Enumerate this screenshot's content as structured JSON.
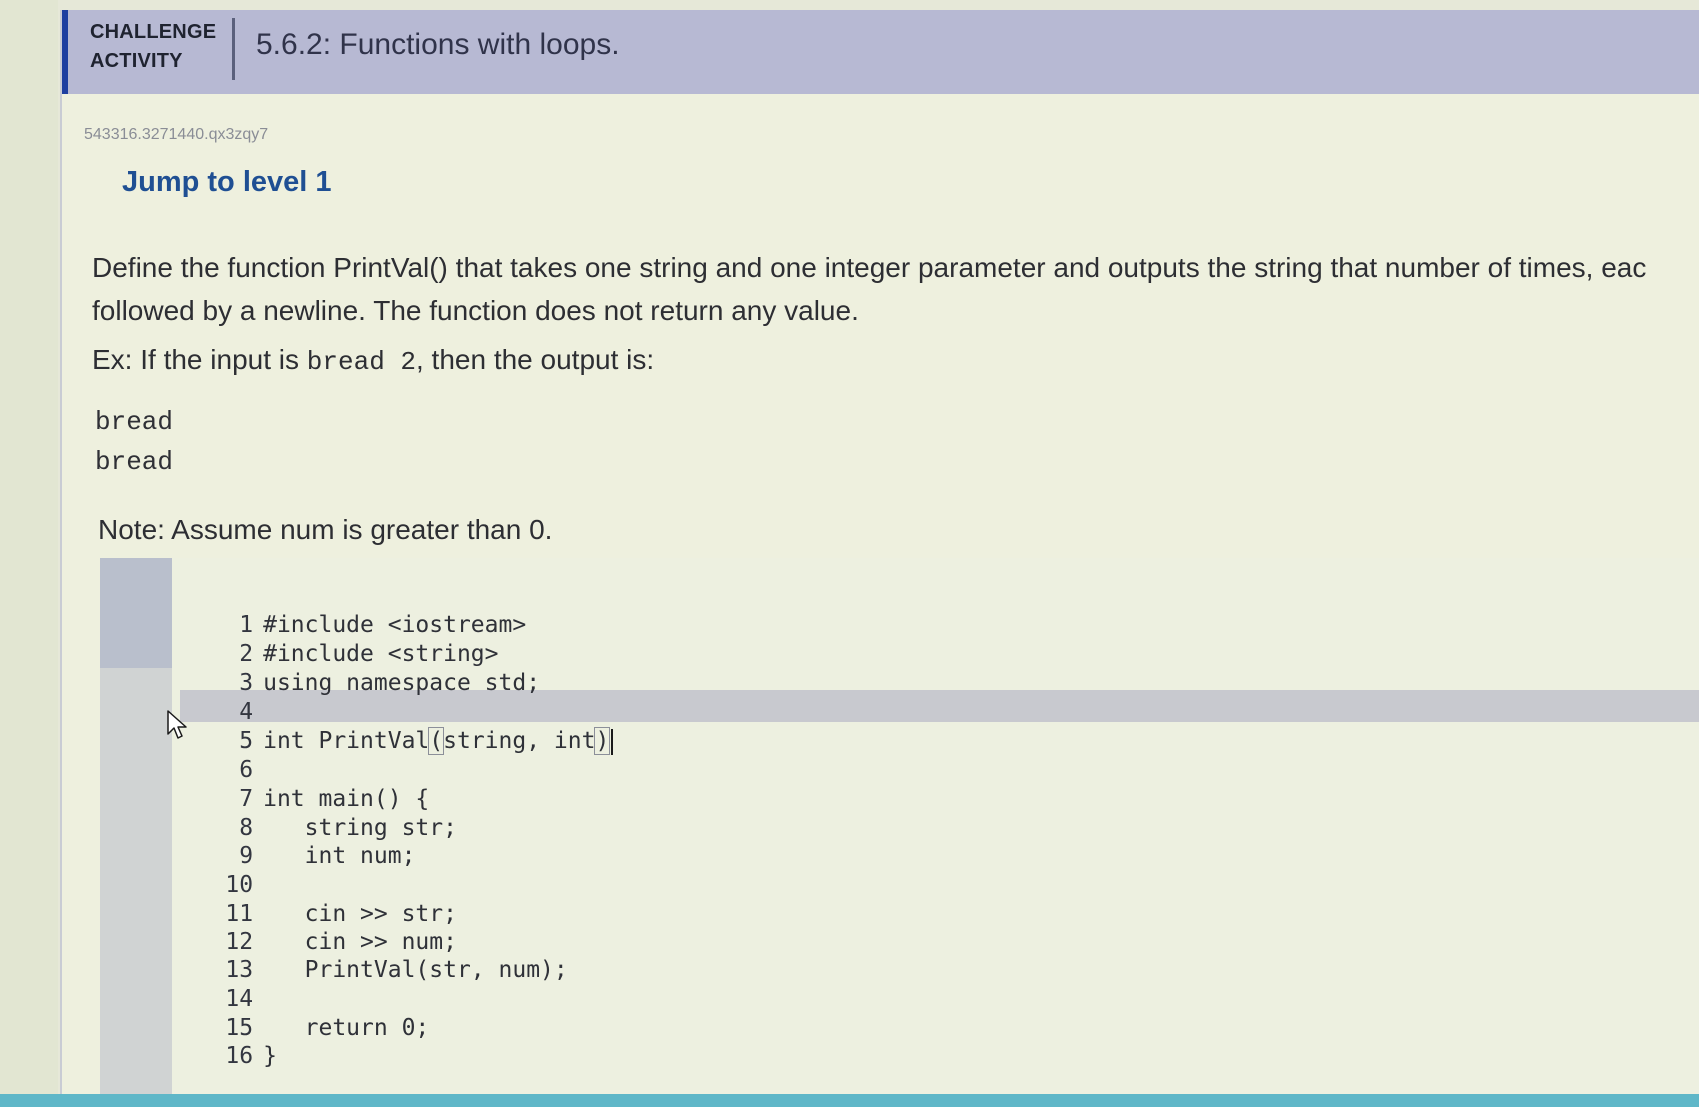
{
  "header": {
    "kind_line1": "CHALLENGE",
    "kind_line2": "ACTIVITY",
    "title": "5.6.2: Functions with loops."
  },
  "activity_id": "543316.3271440.qx3zqy7",
  "jump_level": "Jump to level 1",
  "prompt": {
    "line1": "Define the function PrintVal() that takes one string and one integer parameter and outputs the string that number of times, eac",
    "line2": "followed by a newline. The function does not return any value."
  },
  "example": {
    "prefix": "Ex: If the input is ",
    "input_code": "bread 2",
    "suffix": ", then the output is:"
  },
  "expected_output": [
    "bread",
    "bread"
  ],
  "note": "Note: Assume num is greater than 0.",
  "editor": {
    "lines": [
      {
        "num": "1",
        "code": "#include <iostream>"
      },
      {
        "num": "2",
        "code": "#include <string>"
      },
      {
        "num": "3",
        "code": "using namespace std;"
      },
      {
        "num": "4",
        "code": ""
      },
      {
        "num": "5",
        "code_pre": "int PrintVal",
        "code_open": "(",
        "code_mid": "string, int",
        "code_close": ")"
      },
      {
        "num": "6",
        "code": ""
      },
      {
        "num": "7",
        "code": "int main() {"
      },
      {
        "num": "8",
        "code": "   string str;"
      },
      {
        "num": "9",
        "code": "   int num;"
      },
      {
        "num": "10",
        "code": ""
      },
      {
        "num": "11",
        "code": "   cin >> str;"
      },
      {
        "num": "12",
        "code": "   cin >> num;"
      },
      {
        "num": "13",
        "code": "   PrintVal(str, num);"
      },
      {
        "num": "14",
        "code": ""
      },
      {
        "num": "15",
        "code": "   return 0;"
      },
      {
        "num": "16",
        "code": "}"
      }
    ],
    "active_line": 5
  },
  "colors": {
    "header_bg": "#b7b9d3",
    "header_accent": "#1e3fa0",
    "jump_level": "#1f4f93",
    "page_bg": "#eef0de"
  }
}
